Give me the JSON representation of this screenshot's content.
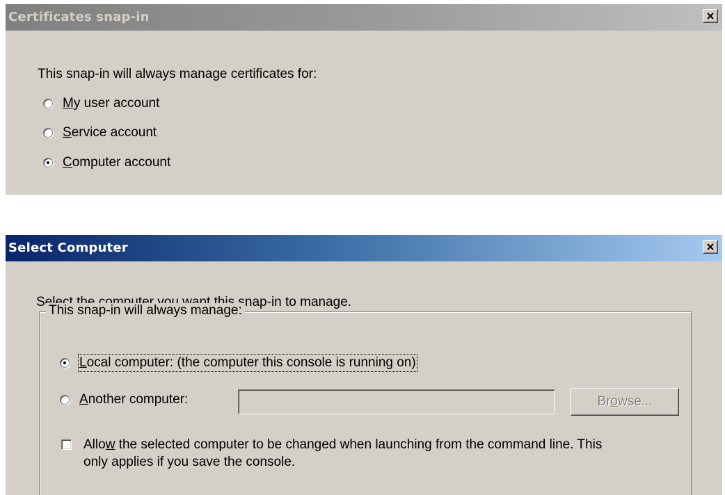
{
  "dialog1": {
    "title": "Certificates snap-in",
    "prompt": "This snap-in will always manage certificates for:",
    "options": [
      {
        "pre": "",
        "key": "M",
        "post": "y user account",
        "checked": false
      },
      {
        "pre": "",
        "key": "S",
        "post": "ervice account",
        "checked": false
      },
      {
        "pre": "",
        "key": "C",
        "post": "omputer account",
        "checked": true
      }
    ]
  },
  "dialog2": {
    "title": "Select Computer",
    "prompt": "Select the computer you want this snap-in to manage.",
    "group_label": "This snap-in will always manage:",
    "local": {
      "pre": "",
      "key": "L",
      "post": "ocal computer:  (the computer this console is running on)",
      "checked": true
    },
    "another": {
      "pre": "",
      "key": "A",
      "post": "nother computer:",
      "checked": false
    },
    "another_value": "",
    "browse": {
      "pre": "Br",
      "key": "o",
      "post": "wse..."
    },
    "allow": {
      "pre": "Allo",
      "key": "w",
      "post": " the selected computer to be changed when launching from the command line.  This",
      "line2": "only applies if you save the console.",
      "checked": false
    }
  },
  "colors": {
    "dialog_bg": "#d4d0c8",
    "active_title_start": "#0a246a",
    "active_title_end": "#a6caf0",
    "inactive_title_start": "#808080",
    "inactive_title_end": "#c0c0c0"
  },
  "icons": {
    "close": "close-x-icon"
  }
}
